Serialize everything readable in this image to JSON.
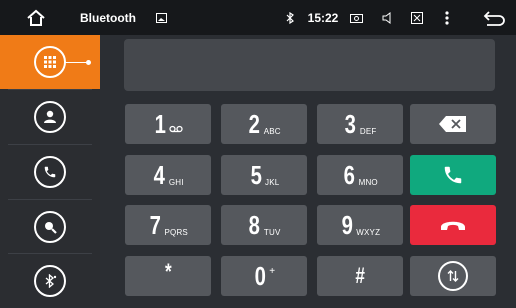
{
  "status_bar": {
    "title": "Bluetooth",
    "time": "15:22",
    "icons": [
      "home-icon",
      "gallery-icon",
      "bluetooth-icon",
      "camera-icon",
      "volume-icon",
      "close-box-icon",
      "more-vert-icon",
      "back-icon"
    ]
  },
  "sidebar": {
    "items": [
      {
        "name": "dialpad",
        "icon": "dialpad-icon",
        "active": true
      },
      {
        "name": "contacts",
        "icon": "person-icon",
        "active": false
      },
      {
        "name": "call-log",
        "icon": "phone-icon",
        "active": false
      },
      {
        "name": "search",
        "icon": "search-icon",
        "active": false
      },
      {
        "name": "bt-settings",
        "icon": "bluetooth-settings-icon",
        "active": false
      }
    ]
  },
  "dialer": {
    "number": "",
    "keys": [
      {
        "d": "1",
        "s": "oo"
      },
      {
        "d": "2",
        "s": "ABC"
      },
      {
        "d": "3",
        "s": "DEF"
      },
      {
        "d": "4",
        "s": "GHI"
      },
      {
        "d": "5",
        "s": "JKL"
      },
      {
        "d": "6",
        "s": "MNO"
      },
      {
        "d": "7",
        "s": "PQRS"
      },
      {
        "d": "8",
        "s": "TUV"
      },
      {
        "d": "9",
        "s": "WXYZ"
      },
      {
        "d": "*",
        "s": ""
      },
      {
        "d": "0",
        "s": "+"
      },
      {
        "d": "#",
        "s": ""
      }
    ],
    "colors": {
      "call": "#10a97e",
      "end": "#ea2a3d",
      "accent": "#f07b17"
    }
  }
}
